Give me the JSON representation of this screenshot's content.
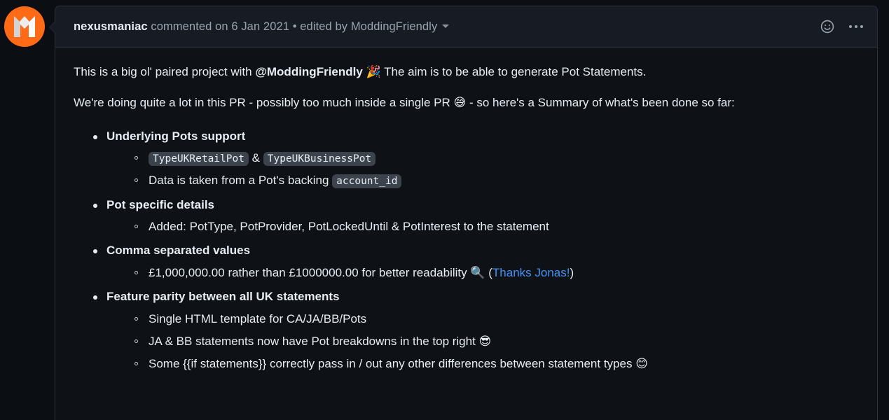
{
  "avatar": {
    "name": "nexusmaniac-avatar",
    "bg_color": "#ff6a16",
    "glyph_color": "#e8e8e8",
    "icon": "monzo-logo-icon"
  },
  "header": {
    "author": "nexusmaniac",
    "meta": " commented on 6 Jan 2021 • edited by ModdingFriendly",
    "commented_on_text": "commented on",
    "date": "6 Jan 2021",
    "separator": "•",
    "edited_by_text": "edited by",
    "editor": "ModdingFriendly",
    "caret_icon": "chevron-down-icon",
    "reaction_icon": "smiley-face-icon",
    "menu_icon": "kebab-menu-icon"
  },
  "body": {
    "paragraph1": {
      "before_mention": "This is a big ol' paired project with ",
      "mention": "@ModdingFriendly",
      "emoji": "🎉",
      "after_mention": " The aim is to be able to generate Pot Statements."
    },
    "paragraph2": {
      "before_emoji": "We're doing quite a lot in this PR - possibly too much inside a single PR ",
      "emoji": "😅",
      "after_emoji": " - so here's a Summary of what's been done so far:"
    },
    "list": [
      {
        "label": "Underlying Pots support",
        "sub": [
          {
            "parts": [
              {
                "type": "code",
                "text": "TypeUKRetailPot"
              },
              {
                "type": "text",
                "text": " & "
              },
              {
                "type": "code",
                "text": "TypeUKBusinessPot"
              }
            ]
          },
          {
            "parts": [
              {
                "type": "text",
                "text": "Data is taken from a Pot's backing "
              },
              {
                "type": "code",
                "text": "account_id"
              }
            ]
          }
        ]
      },
      {
        "label": "Pot specific details",
        "sub": [
          {
            "parts": [
              {
                "type": "text",
                "text": "Added: PotType, PotProvider, PotLockedUntil & PotInterest to the statement"
              }
            ]
          }
        ]
      },
      {
        "label": "Comma separated values",
        "sub": [
          {
            "parts": [
              {
                "type": "text",
                "text": "£1,000,000.00 rather than £1000000.00 for better readability "
              },
              {
                "type": "emoji",
                "text": "🔍"
              },
              {
                "type": "text",
                "text": " ("
              },
              {
                "type": "link",
                "text": "Thanks Jonas!"
              },
              {
                "type": "text",
                "text": ")"
              }
            ]
          }
        ]
      },
      {
        "label": "Feature parity between all UK statements",
        "sub": [
          {
            "parts": [
              {
                "type": "text",
                "text": "Single HTML template for CA/JA/BB/Pots"
              }
            ]
          },
          {
            "parts": [
              {
                "type": "text",
                "text": "JA & BB statements now have Pot breakdowns in the top right "
              },
              {
                "type": "emoji",
                "text": "😎"
              }
            ]
          },
          {
            "parts": [
              {
                "type": "text",
                "text": "Some {{if statements}} correctly pass in / out any other differences between statement types "
              },
              {
                "type": "emoji",
                "text": "😊"
              }
            ]
          }
        ]
      }
    ]
  },
  "colors": {
    "page_bg": "#0b0e13",
    "card_bg": "#0e1116",
    "header_bg": "#171c24",
    "border": "#2b313a",
    "text": "#e6edf3",
    "muted_text": "#8b949e",
    "link": "#4493f8",
    "code_bg": "#3d434c",
    "accent_orange": "#ff6a16"
  }
}
